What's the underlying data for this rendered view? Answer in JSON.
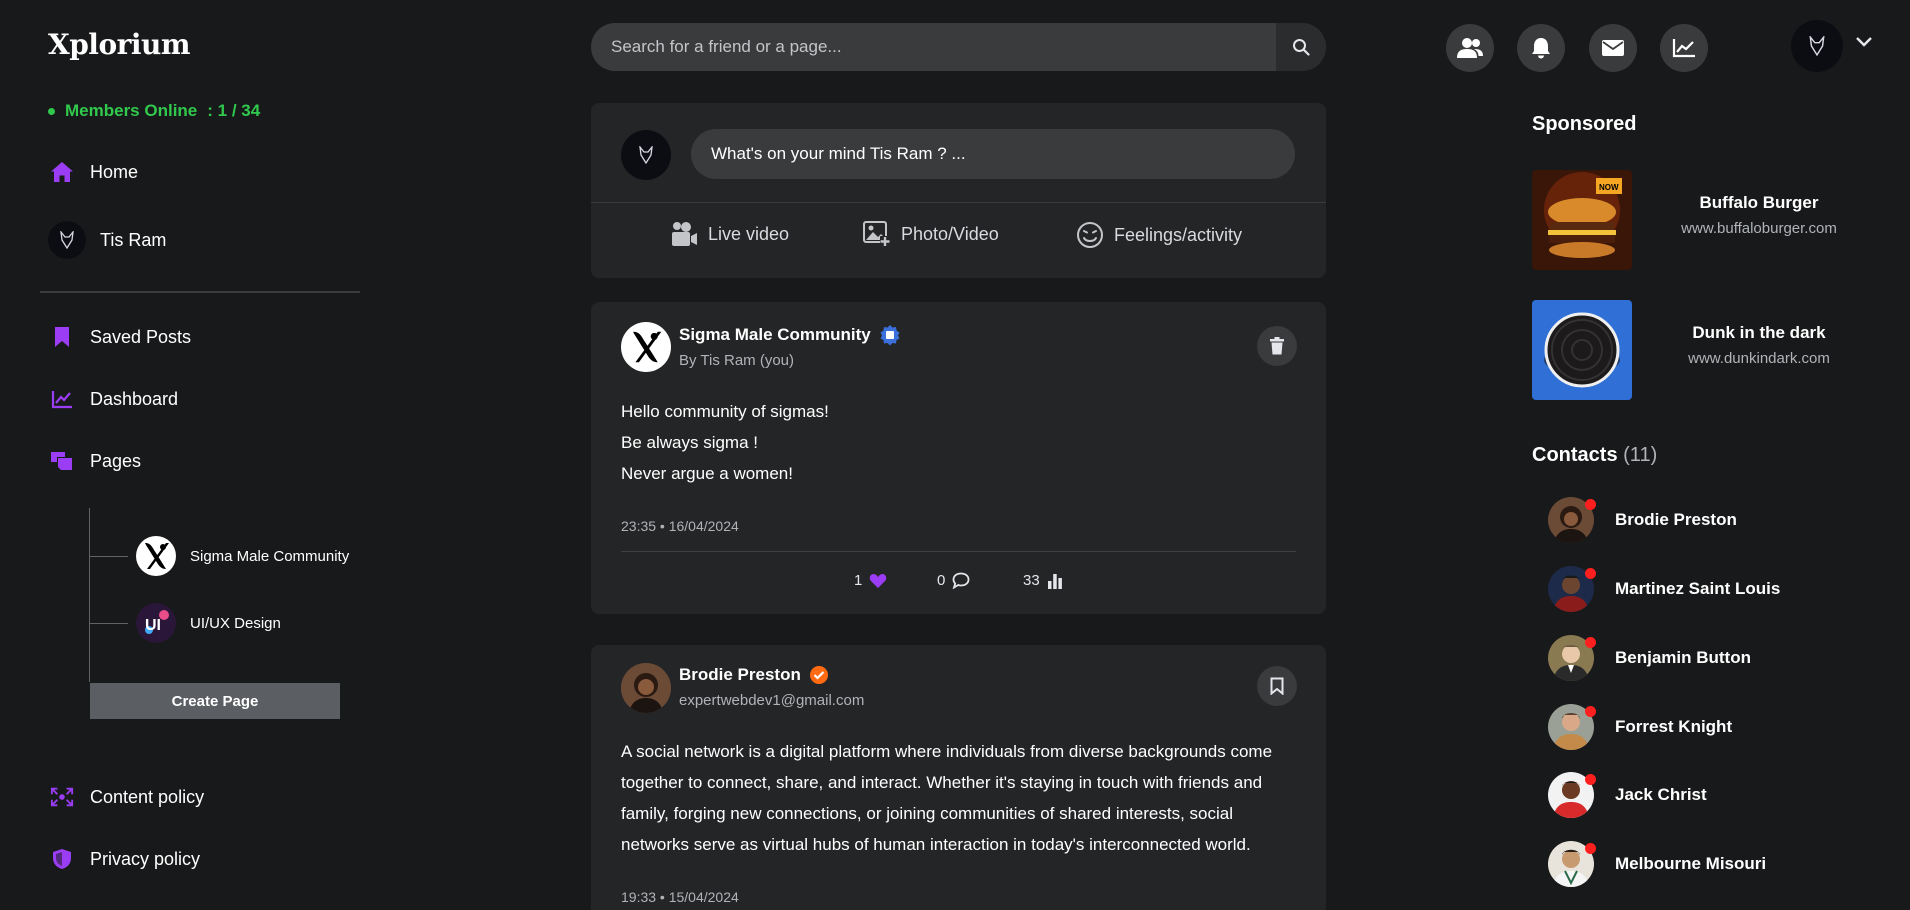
{
  "app": {
    "logo": "Xplorium"
  },
  "sidebar": {
    "online_label": "Members Online",
    "online_count": ":  1 / 34",
    "home": "Home",
    "user": "Tis Ram",
    "saved": "Saved Posts",
    "dashboard": "Dashboard",
    "pages": "Pages",
    "page_list": [
      {
        "name": "Sigma Male Community"
      },
      {
        "name": "UI/UX Design"
      }
    ],
    "create_page": "Create Page",
    "content_policy": "Content policy",
    "privacy_policy": "Privacy policy"
  },
  "search": {
    "placeholder": "Search for a friend or a page..."
  },
  "composer": {
    "prompt": "What's on your mind Tis Ram ? ...",
    "live": "Live video",
    "photo": "Photo/Video",
    "feelings": "Feelings/activity"
  },
  "posts": [
    {
      "author": "Sigma Male Community",
      "sub": "By Tis Ram (you)",
      "lines": [
        "Hello community of sigmas!",
        "Be always sigma !",
        "Never argue a women!"
      ],
      "time": "23:35 • 16/04/2024",
      "likes": "1",
      "comments": "0",
      "views": "33"
    },
    {
      "author": "Brodie Preston",
      "sub": "expertwebdev1@gmail.com",
      "lines": [
        "A social network is a digital platform where individuals from diverse backgrounds come",
        "together to connect, share, and interact. Whether it's staying in touch with friends and",
        "family, forging new connections, or joining communities of shared interests, social",
        "networks serve as virtual hubs of human interaction in today's interconnected world."
      ],
      "time": "19:33 • 15/04/2024"
    }
  ],
  "sponsored": {
    "title": "Sponsored",
    "ads": [
      {
        "name": "Buffalo Burger",
        "url": "www.buffaloburger.com"
      },
      {
        "name": "Dunk in the dark",
        "url": "www.dunkindark.com"
      }
    ]
  },
  "contacts": {
    "title": "Contacts",
    "count": "(11)",
    "list": [
      {
        "name": "Brodie Preston"
      },
      {
        "name": "Martinez Saint Louis"
      },
      {
        "name": "Benjamin Button"
      },
      {
        "name": "Forrest Knight"
      },
      {
        "name": "Jack Christ"
      },
      {
        "name": "Melbourne Misouri"
      }
    ]
  },
  "colors": {
    "accent": "#9b3df5",
    "online": "#31c94d",
    "status_offline": "#ff1f1f",
    "verified": "#ff6a13",
    "page_badge": "#3b6fdc"
  }
}
